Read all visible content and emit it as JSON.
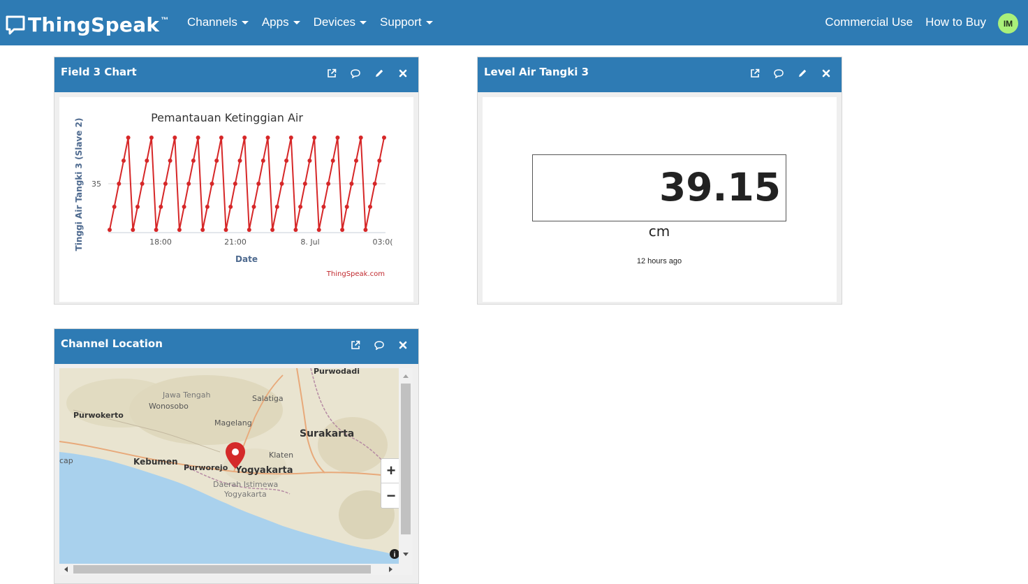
{
  "navbar": {
    "brand": "ThingSpeak",
    "trademark": "™",
    "menu": [
      {
        "label": "Channels"
      },
      {
        "label": "Apps"
      },
      {
        "label": "Devices"
      },
      {
        "label": "Support"
      }
    ],
    "right_links": [
      {
        "label": "Commercial Use"
      },
      {
        "label": "How to Buy"
      }
    ],
    "avatar_initials": "IM"
  },
  "widgets": {
    "field_chart": {
      "title": "Field 3 Chart",
      "tools": [
        "external-link-icon",
        "comment-icon",
        "pencil-icon",
        "close-icon"
      ]
    },
    "level_display": {
      "title": "Level Air Tangki 3",
      "value": "39.15",
      "unit": "cm",
      "updated": "12 hours ago",
      "tools": [
        "external-link-icon",
        "comment-icon",
        "pencil-icon",
        "close-icon"
      ]
    },
    "channel_location": {
      "title": "Channel Location",
      "tools": [
        "external-link-icon",
        "comment-icon",
        "close-icon"
      ],
      "zoom_in": "+",
      "zoom_out": "−",
      "places": [
        {
          "label": "Purwodadi"
        },
        {
          "label": "Jawa Tengah"
        },
        {
          "label": "Wonosobo"
        },
        {
          "label": "Salatiga"
        },
        {
          "label": "Purwokerto"
        },
        {
          "label": "Magelang"
        },
        {
          "label": "Surakarta"
        },
        {
          "label": "Klaten"
        },
        {
          "label": "cap"
        },
        {
          "label": "Kebumen"
        },
        {
          "label": "Purworejo"
        },
        {
          "label": "Yogyakarta"
        },
        {
          "label": "Daerah Istimewa"
        },
        {
          "label": "Yogyakarta"
        }
      ]
    }
  },
  "chart_data": {
    "type": "line",
    "title": "Pemantauan Ketinggian Air",
    "xlabel": "Date",
    "ylabel": "Tinggi Air Tangki 3 (Slave 2)",
    "credit": "ThingSpeak.com",
    "ytick_labels": [
      "35"
    ],
    "xtick_labels": [
      "18:00",
      "21:00",
      "8. Jul",
      "03:0("
    ],
    "ylim": [
      25,
      45
    ],
    "series": [
      {
        "color": "#d62728",
        "values": [
          25,
          30,
          35,
          40,
          45,
          25,
          30,
          35,
          40,
          45,
          25,
          30,
          35,
          40,
          45,
          25,
          30,
          35,
          40,
          45,
          25,
          30,
          35,
          40,
          45,
          25,
          30,
          35,
          40,
          45,
          25,
          30,
          35,
          40,
          45,
          25,
          30,
          35,
          40,
          45,
          25,
          30,
          35,
          40,
          45,
          25,
          30,
          35,
          40,
          45,
          25,
          30,
          35,
          40,
          45,
          25,
          30,
          35,
          40,
          45
        ]
      }
    ],
    "grid": false
  },
  "colors": {
    "navbar": "#2e7bb4",
    "widget_header": "#2e7bb4",
    "line": "#d62728",
    "avatar": "#aaf07a",
    "map_water": "#a9d1ed",
    "map_land": "#e9e4d0",
    "pin": "#d42a2a"
  }
}
